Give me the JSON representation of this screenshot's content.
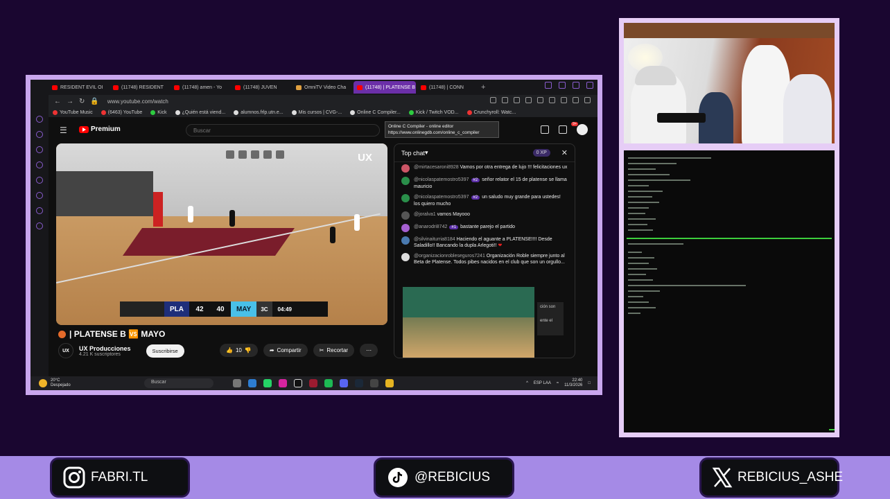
{
  "browser": {
    "tabs": [
      {
        "label": "RESIDENT EVIL OI",
        "active": false
      },
      {
        "label": "(11748) RESIDENT",
        "active": false
      },
      {
        "label": "(11748) amen - Yo",
        "active": false
      },
      {
        "label": "(11748) JUVEN",
        "active": false
      },
      {
        "label": "OmniTV Video Cha",
        "active": false
      },
      {
        "label": "(11748) | PLATENSE B",
        "active": true
      },
      {
        "label": "(11748) | CONN",
        "active": false
      }
    ],
    "url": "www.youtube.com/watch",
    "bookmarks": [
      "YouTube Music",
      "(6463) YouTube",
      "Kick",
      "¿Quién está viend...",
      "alumnos.frlp.utn.e...",
      "Mis cursos | CVG-...",
      "Online C Compiler...",
      "Kick / Twitch VOD...",
      "Crunchyroll: Watc..."
    ],
    "tooltip": {
      "title": "Online C Compiler - online editor",
      "url": "https://www.onlinegdb.com/online_c_compiler"
    }
  },
  "youtube": {
    "logo": "Premium",
    "search_placeholder": "Buscar",
    "notif_count": "9+",
    "video": {
      "watermark": "UX",
      "scoreboard": {
        "home_team": "PLA",
        "home_score": "42",
        "away_score": "40",
        "away_team": "MAY",
        "quarter": "3C",
        "clock": "04:49"
      }
    },
    "title": "| PLATENSE B 🆚 MAYO",
    "channel": {
      "avatar_text": "UX",
      "name": "UX Producciones",
      "subs": "4.21 K suscriptores"
    },
    "subscribe_label": "Suscribirse",
    "like_count": "10",
    "share_label": "Compartir",
    "clip_label": "Recortar"
  },
  "chat": {
    "title": "Top chat",
    "xp": "0 XP",
    "messages": [
      {
        "user": "@mirtacesaroni8928",
        "badge": "",
        "text": "Vamos por otra entrega de lujo !!! felicitaciones ux"
      },
      {
        "user": "@nicolaspatemostro5397",
        "badge": "#2",
        "text": "señor relator el 15 de platense se llama mauricio"
      },
      {
        "user": "@nicolaspatemostro5397",
        "badge": "#2",
        "text": "un saludo muy grande para ustedes! los quiero mucho"
      },
      {
        "user": "@joralva1",
        "badge": "",
        "text": "vamos Mayooo"
      },
      {
        "user": "@anarodri8742",
        "badge": "#1",
        "text": "bastante parejo el partido"
      },
      {
        "user": "@silvinaiturria8184",
        "badge": "",
        "text": "Haciendo el aguante a PLATENSE!!!! Desde Saladillo!! Bancando la dupla Arlegoti!!"
      },
      {
        "user": "@organizacionrobleseguros7241",
        "badge": "",
        "text": "Organización Roble siempre junto al Beta de Platense. Todos pibes nacidos en el club que son un orgullo..."
      }
    ],
    "overlay_text_1": "ción son",
    "overlay_text_2": "ente el"
  },
  "taskbar": {
    "temperature": "20°C",
    "weather": "Despejado",
    "search": "Buscar",
    "lang": "ESP\nLAA",
    "time": "22:40",
    "date": "11/3/2026"
  },
  "socials": {
    "instagram": "FABRI.TL",
    "tiktok": "@REBICIUS",
    "x": "REBICIUS_ASHE"
  },
  "colors": {
    "background": "#1a0630",
    "frame_border": "#c9a6ee",
    "footer": "#a58ae6",
    "active_tab": "#6b2fa8"
  }
}
